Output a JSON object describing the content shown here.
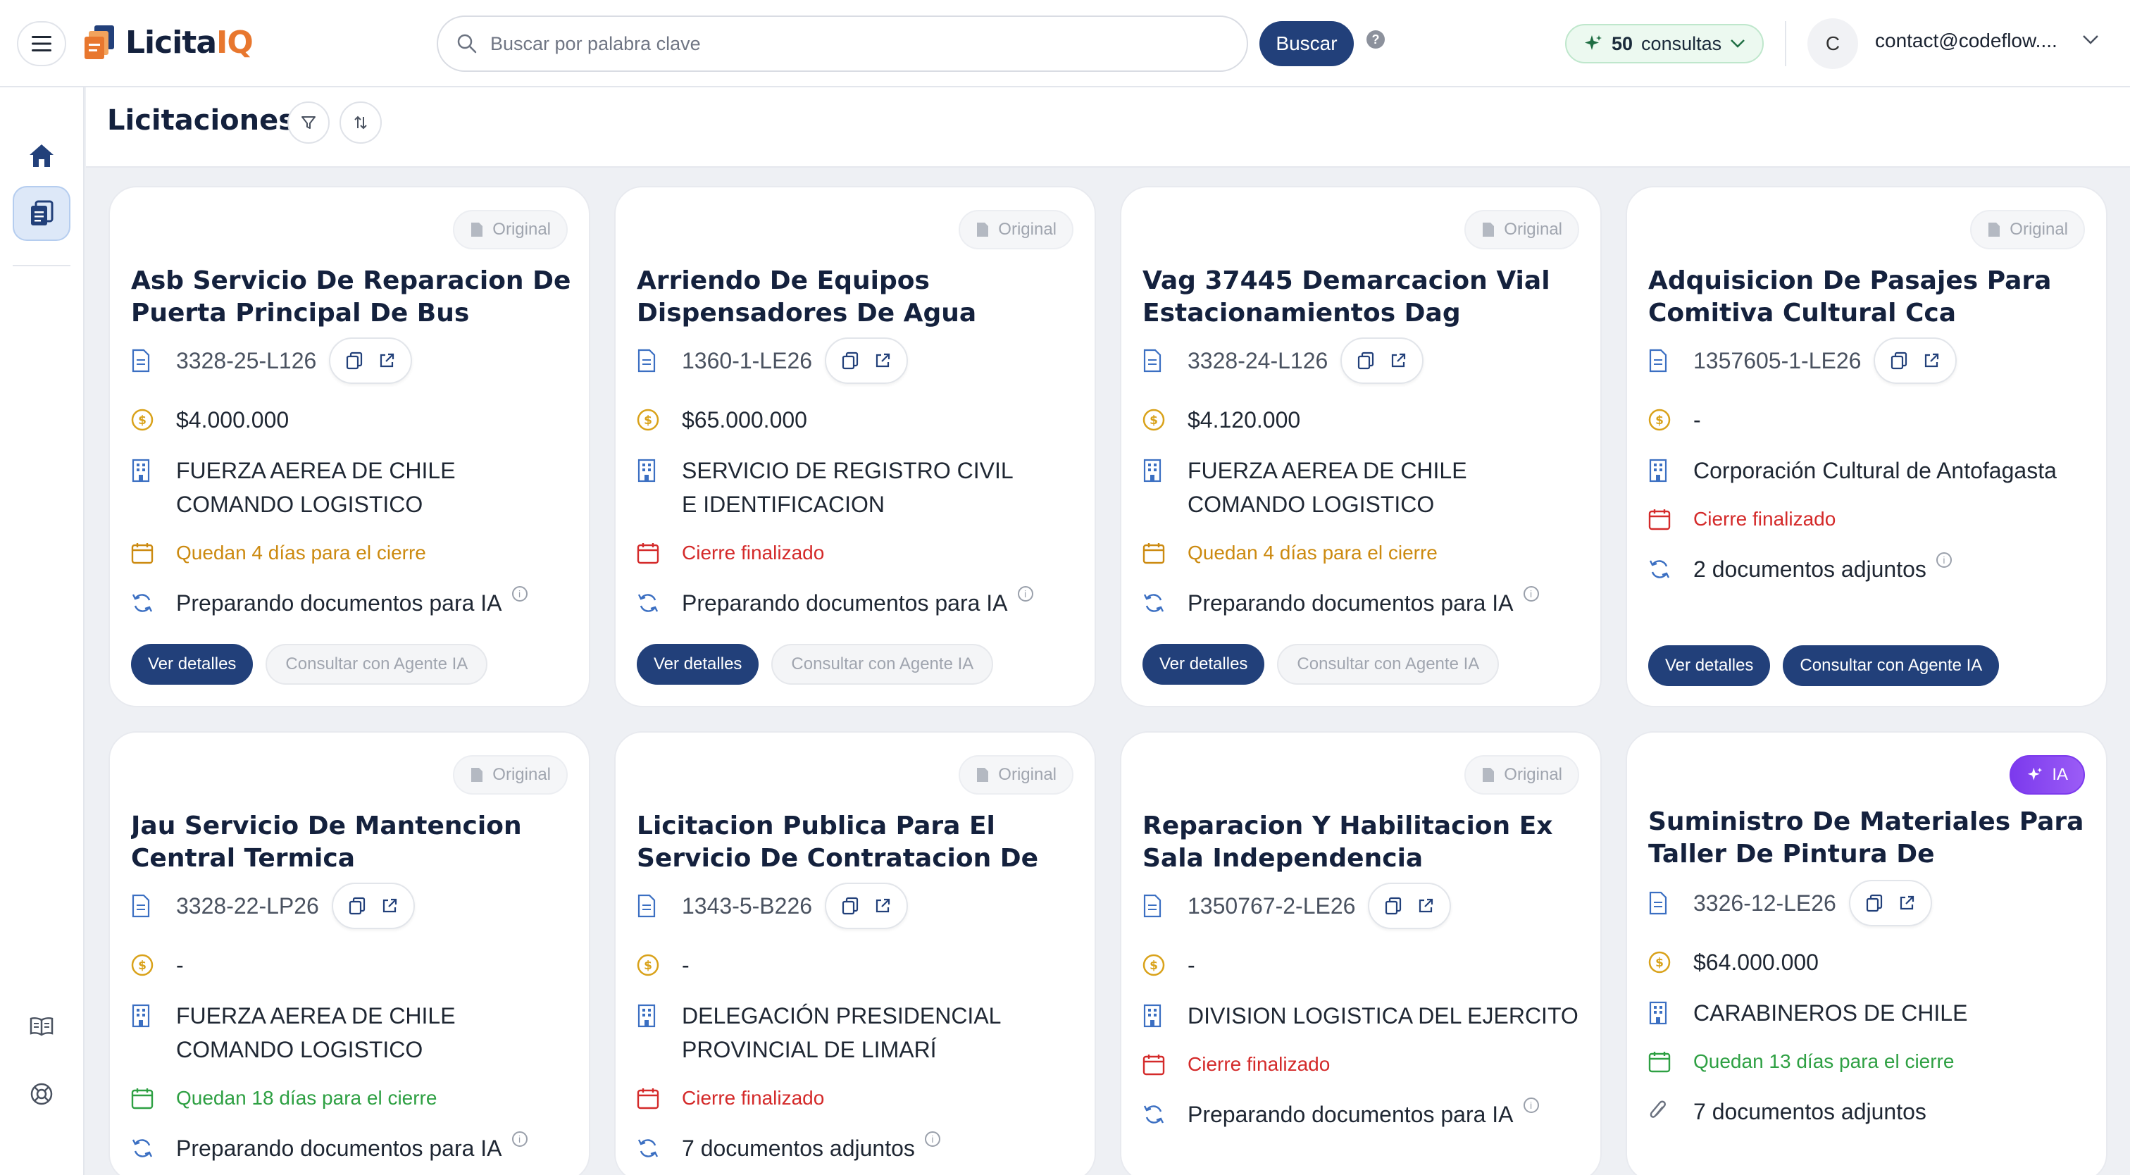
{
  "header": {
    "brand_part1": "Licita",
    "brand_part2": "IQ",
    "search_placeholder": "Buscar por palabra clave",
    "search_button": "Buscar",
    "help_glyph": "?",
    "credits_count": "50",
    "credits_label": "consultas",
    "avatar_initial": "C",
    "user_email": "contact@codeflow...."
  },
  "page": {
    "title": "Licitaciones"
  },
  "cards": [
    {
      "badge": "Original",
      "title": "Asb Servicio De Reparacion De Puerta Principal De Bus",
      "id": "3328-25-L126",
      "amount": "$4.000.000",
      "org": "FUERZA AEREA DE CHILE COMANDO LOGISTICO",
      "deadline": "Quedan 4 días para el cierre",
      "deadline_status": "amber",
      "docs": "Preparando documentos para IA",
      "details_button": "Ver detalles",
      "agent_button": "Consultar con Agente IA",
      "agent_enabled": false
    },
    {
      "badge": "Original",
      "title": "Arriendo De Equipos Dispensadores De Agua",
      "id": "1360-1-LE26",
      "amount": "$65.000.000",
      "org": "SERVICIO DE REGISTRO CIVIL E IDENTIFICACION",
      "deadline": "Cierre finalizado",
      "deadline_status": "red",
      "docs": "Preparando documentos para IA",
      "details_button": "Ver detalles",
      "agent_button": "Consultar con Agente IA",
      "agent_enabled": false
    },
    {
      "badge": "Original",
      "title": "Vag 37445 Demarcacion Vial Estacionamientos Dag",
      "id": "3328-24-L126",
      "amount": "$4.120.000",
      "org": "FUERZA AEREA DE CHILE COMANDO LOGISTICO",
      "deadline": "Quedan 4 días para el cierre",
      "deadline_status": "amber",
      "docs": "Preparando documentos para IA",
      "details_button": "Ver detalles",
      "agent_button": "Consultar con Agente IA",
      "agent_enabled": false
    },
    {
      "badge": "Original",
      "title": "Adquisicion De Pasajes Para Comitiva Cultural Cca",
      "id": "1357605-1-LE26",
      "amount": "-",
      "org": "Corporación Cultural de Antofagasta",
      "deadline": "Cierre finalizado",
      "deadline_status": "red",
      "docs": "2 documentos adjuntos",
      "details_button": "Ver detalles",
      "agent_button": "Consultar con Agente IA",
      "agent_enabled": true
    },
    {
      "badge": "Original",
      "title": "Jau Servicio De Mantencion Central Termica",
      "id": "3328-22-LP26",
      "amount": "-",
      "org": "FUERZA AEREA DE CHILE COMANDO LOGISTICO",
      "deadline": "Quedan 18 días para el cierre",
      "deadline_status": "green",
      "docs": "Preparando documentos para IA"
    },
    {
      "badge": "Original",
      "title": "Licitacion Publica Para El Servicio De Contratacion De Suministro...",
      "id": "1343-5-B226",
      "amount": "-",
      "org": "DELEGACIÓN PRESIDENCIAL PROVINCIAL DE LIMARÍ",
      "deadline": "Cierre finalizado",
      "deadline_status": "red",
      "docs": "7 documentos adjuntos"
    },
    {
      "badge": "Original",
      "title": "Reparacion Y Habilitacion Ex Sala Independencia",
      "id": "1350767-2-LE26",
      "amount": "-",
      "org": "DIVISION LOGISTICA DEL EJERCITO",
      "deadline": "Cierre finalizado",
      "deadline_status": "red",
      "docs": "Preparando documentos para IA"
    },
    {
      "badge": "IA",
      "title": "Suministro De Materiales Para Taller De Pintura De Carabinero...",
      "id": "3326-12-LE26",
      "amount": "$64.000.000",
      "org": "CARABINEROS DE CHILE",
      "deadline": "Quedan 13 días para el cierre",
      "deadline_status": "green",
      "docs": "7 documentos adjuntos"
    }
  ]
}
